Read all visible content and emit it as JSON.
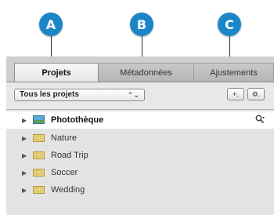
{
  "callouts": [
    "A",
    "B",
    "C"
  ],
  "tabs": [
    "Projets",
    "Métadonnées",
    "Ajustements"
  ],
  "toolbar": {
    "project_filter": "Tous les projets",
    "select_arrows": "⌃⌄",
    "add_button": "+.",
    "action_button": "⚙."
  },
  "library": {
    "label": "Photothèque",
    "search_icon": "magnifier"
  },
  "projects": [
    "Nature",
    "Road Trip",
    "Soccer",
    "Wedding"
  ],
  "colors": {
    "callout": "#1a86c8",
    "panel": "#cfcfcf",
    "folder": "#e6cf78"
  }
}
